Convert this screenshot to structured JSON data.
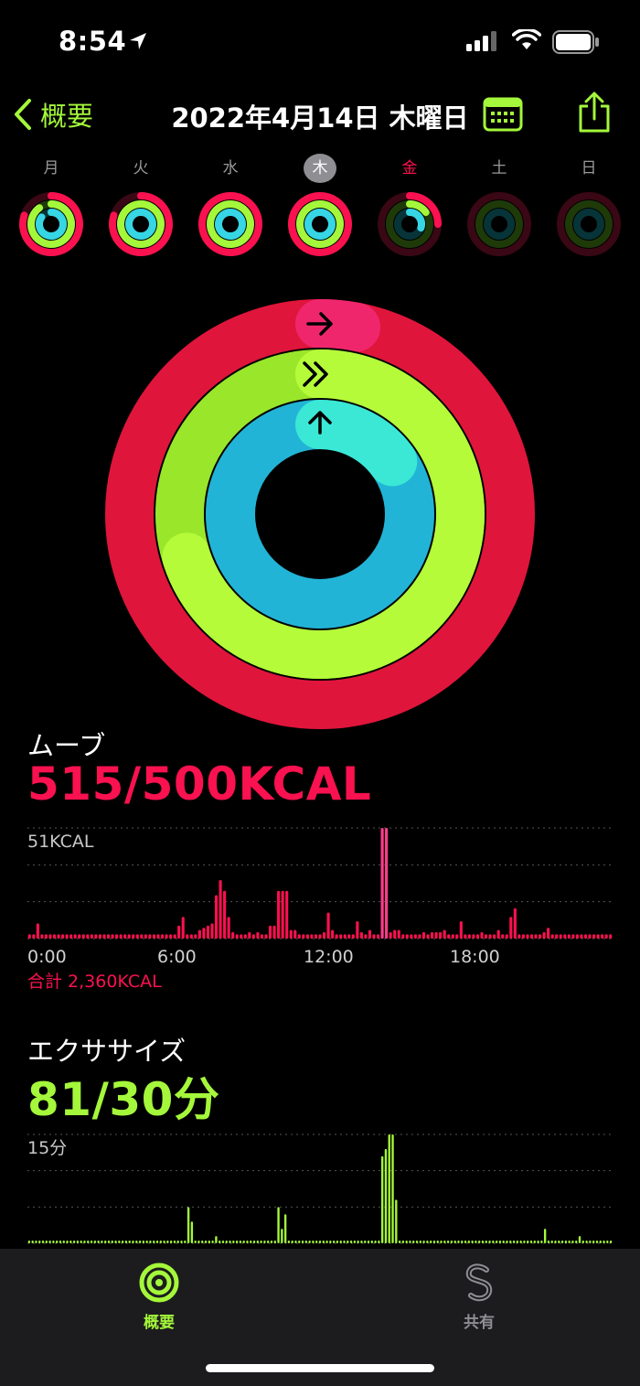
{
  "status": {
    "time": "8:54"
  },
  "nav": {
    "back_label": "概要",
    "title": "2022年4月14日 木曜日"
  },
  "colors": {
    "move": "#fa114f",
    "exercise": "#a4f73a",
    "stand": "#36d6e4"
  },
  "week": [
    {
      "label": "月",
      "move": 0.8,
      "exercise": 0.9,
      "stand": 0.85,
      "selected": false,
      "today": false
    },
    {
      "label": "火",
      "move": 0.8,
      "exercise": 1.0,
      "stand": 1.0,
      "selected": false,
      "today": false
    },
    {
      "label": "水",
      "move": 1.0,
      "exercise": 1.0,
      "stand": 1.0,
      "selected": false,
      "today": false
    },
    {
      "label": "木",
      "move": 1.0,
      "exercise": 1.0,
      "stand": 1.0,
      "selected": true,
      "today": false
    },
    {
      "label": "金",
      "move": 0.25,
      "exercise": 0.15,
      "stand": 0.3,
      "selected": false,
      "today": true
    },
    {
      "label": "土",
      "move": 0,
      "exercise": 0,
      "stand": 0,
      "selected": false,
      "today": false
    },
    {
      "label": "日",
      "move": 0,
      "exercise": 0,
      "stand": 0,
      "selected": false,
      "today": false
    }
  ],
  "rings": {
    "move": 1.03,
    "exercise": 2.7,
    "stand": 1.15
  },
  "move": {
    "label": "ムーブ",
    "value": "515/500KCAL",
    "max_label": "51KCAL",
    "total": "合計 2,360KCAL",
    "chart_data": {
      "type": "bar",
      "ymax": 51,
      "xticks": [
        "0:00",
        "6:00",
        "12:00",
        "18:00"
      ],
      "values": [
        2,
        2,
        7,
        2,
        2,
        2,
        2,
        2,
        2,
        2,
        2,
        2,
        2,
        2,
        2,
        2,
        2,
        2,
        2,
        2,
        2,
        2,
        2,
        2,
        2,
        2,
        2,
        2,
        2,
        2,
        2,
        2,
        2,
        2,
        2,
        2,
        6,
        10,
        2,
        2,
        2,
        4,
        5,
        6,
        7,
        20,
        27,
        22,
        10,
        3,
        2,
        2,
        2,
        3,
        2,
        3,
        2,
        2,
        6,
        6,
        22,
        22,
        22,
        4,
        4,
        2,
        2,
        2,
        2,
        2,
        2,
        3,
        12,
        4,
        2,
        2,
        2,
        2,
        2,
        8,
        3,
        2,
        4,
        2,
        2,
        51,
        51,
        3,
        4,
        4,
        2,
        2,
        2,
        2,
        2,
        3,
        2,
        3,
        3,
        3,
        4,
        2,
        2,
        2,
        8,
        2,
        2,
        2,
        2,
        3,
        2,
        2,
        2,
        4,
        2,
        2,
        10,
        14,
        2,
        2,
        2,
        2,
        2,
        2,
        3,
        5,
        2,
        2,
        2,
        2,
        2,
        2,
        2,
        2,
        2,
        2,
        2,
        2,
        2,
        2,
        2
      ],
      "highlight": [
        85,
        86
      ]
    }
  },
  "exercise": {
    "label": "エクササイズ",
    "value": "81/30分",
    "max_label": "15分",
    "chart_data": {
      "type": "bar",
      "ymax": 15,
      "values": [
        0,
        0,
        0,
        0,
        0,
        0,
        0,
        0,
        0,
        0,
        0,
        0,
        0,
        0,
        0,
        0,
        0,
        0,
        0,
        0,
        0,
        0,
        0,
        0,
        0,
        0,
        0,
        0,
        0,
        0,
        0,
        0,
        0,
        0,
        0,
        0,
        0,
        0,
        0,
        0,
        0,
        0,
        0,
        0,
        0,
        0,
        5,
        3,
        0,
        0,
        0,
        0,
        0,
        0,
        1,
        0,
        0,
        0,
        0,
        0,
        0,
        0,
        0,
        0,
        0,
        0,
        0,
        0,
        0,
        0,
        0,
        0,
        5,
        2,
        4,
        0,
        0,
        0,
        0,
        0,
        0,
        0,
        0,
        0,
        0,
        0,
        0,
        0,
        0,
        0,
        0,
        0,
        0,
        0,
        0,
        0,
        0,
        0,
        0,
        0,
        0,
        0,
        12,
        13,
        15,
        15,
        6,
        0,
        0,
        0,
        0,
        0,
        0,
        0,
        0,
        0,
        0,
        0,
        0,
        0,
        0,
        0,
        0,
        0,
        0,
        0,
        0,
        0,
        0,
        0,
        0,
        0,
        0,
        0,
        0,
        0,
        0,
        0,
        0,
        0,
        0,
        0,
        0,
        0,
        0,
        0,
        0,
        0,
        0,
        2,
        0,
        0,
        0,
        0,
        0,
        0,
        0,
        0,
        0,
        1,
        0,
        0,
        0,
        0,
        0,
        0,
        0,
        0,
        0
      ]
    }
  },
  "tabbar": {
    "summary_label": "概要",
    "sharing_label": "共有"
  }
}
